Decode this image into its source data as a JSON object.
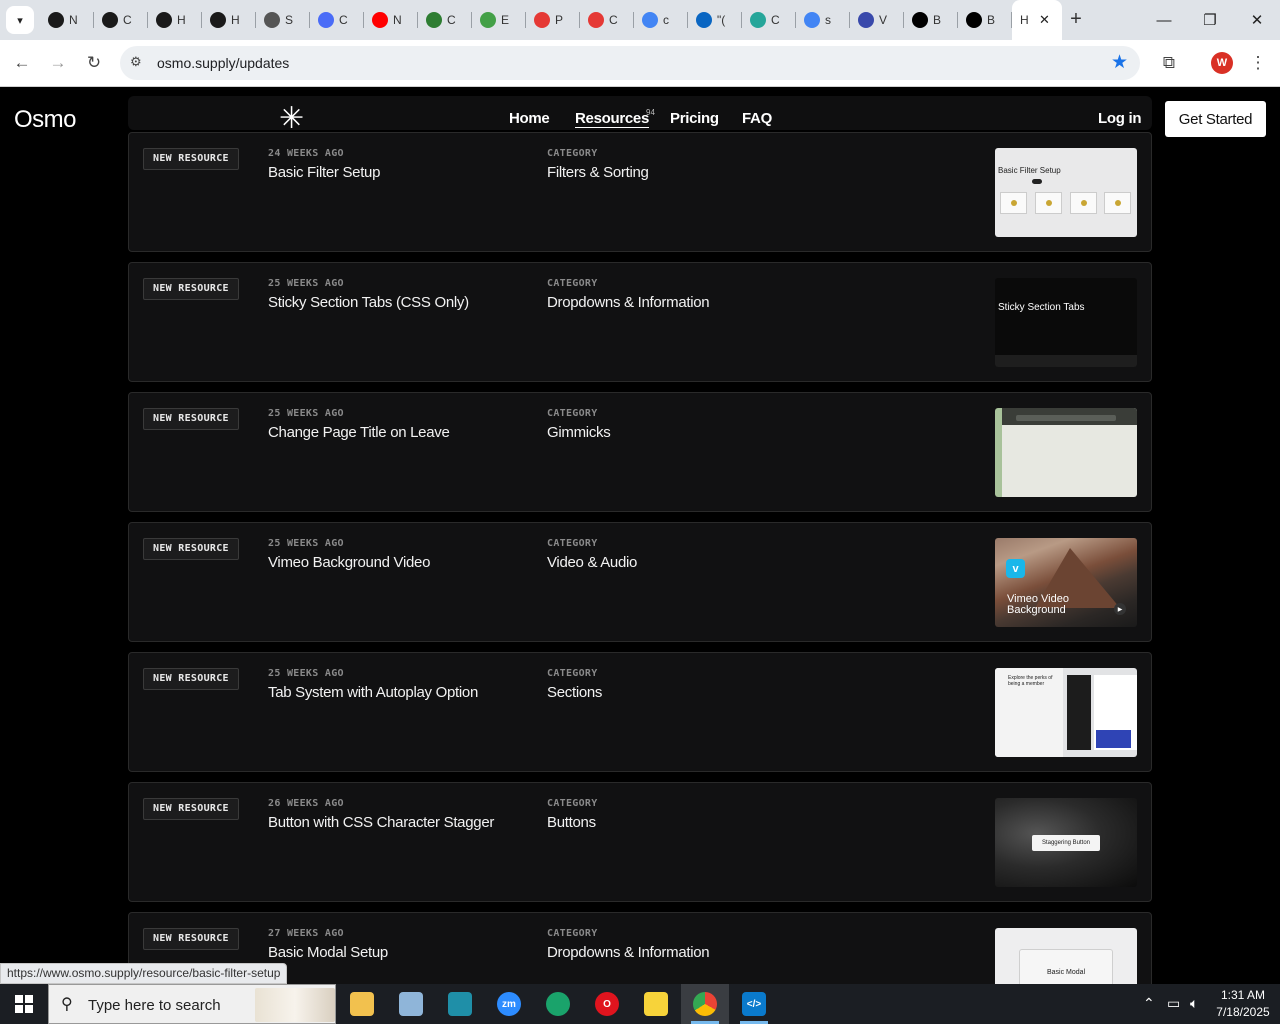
{
  "browser": {
    "tabs": [
      {
        "icon": "openai-icon",
        "label": "N",
        "color": "#1a1a1a"
      },
      {
        "icon": "openai-icon",
        "label": "C",
        "color": "#1a1a1a"
      },
      {
        "icon": "openai-icon",
        "label": "H",
        "color": "#1a1a1a"
      },
      {
        "icon": "openai-icon",
        "label": "H",
        "color": "#1a1a1a"
      },
      {
        "icon": "wordpress-icon",
        "label": "S",
        "color": "#555555"
      },
      {
        "icon": "app-icon",
        "label": "C",
        "color": "#4a6cf7"
      },
      {
        "icon": "youtube-icon",
        "label": "N",
        "color": "#ff0000"
      },
      {
        "icon": "webflow-icon",
        "label": "C",
        "color": "#2e7d32"
      },
      {
        "icon": "app-icon",
        "label": "E",
        "color": "#43a047"
      },
      {
        "icon": "app-icon",
        "label": "P",
        "color": "#e53935"
      },
      {
        "icon": "app-icon",
        "label": "C",
        "color": "#e53935"
      },
      {
        "icon": "google-icon",
        "label": "c",
        "color": "#4285f4"
      },
      {
        "icon": "linkedin-icon",
        "label": "\"(",
        "color": "#0a66c2"
      },
      {
        "icon": "app-icon",
        "label": "C",
        "color": "#26a69a"
      },
      {
        "icon": "google-icon",
        "label": "s",
        "color": "#4285f4"
      },
      {
        "icon": "app-icon",
        "label": "V",
        "color": "#3949ab"
      },
      {
        "icon": "x-icon",
        "label": "B",
        "color": "#000000"
      },
      {
        "icon": "x-icon",
        "label": "B",
        "color": "#000000"
      }
    ],
    "active_tab_label": "H",
    "url": "osmo.supply/updates",
    "profile_initial": "W",
    "status_url": "https://www.osmo.supply/resource/basic-filter-setup"
  },
  "site": {
    "logo": "Osmo",
    "nav": {
      "home": "Home",
      "resources": "Resources",
      "resources_count": "94",
      "pricing": "Pricing",
      "faq": "FAQ",
      "login": "Log in",
      "cta": "Get Started"
    },
    "items": [
      {
        "badge": "NEW RESOURCE",
        "when": "24 WEEKS AGO",
        "title": "Basic Filter Setup",
        "category_label": "CATEGORY",
        "category": "Filters & Sorting",
        "thumb_text": "Basic Filter Setup"
      },
      {
        "badge": "NEW RESOURCE",
        "when": "25 WEEKS AGO",
        "title": "Sticky Section Tabs (CSS Only)",
        "category_label": "CATEGORY",
        "category": "Dropdowns & Information",
        "thumb_text": "Sticky Section Tabs"
      },
      {
        "badge": "NEW RESOURCE",
        "when": "25 WEEKS AGO",
        "title": "Change Page Title on Leave",
        "category_label": "CATEGORY",
        "category": "Gimmicks",
        "thumb_text": ""
      },
      {
        "badge": "NEW RESOURCE",
        "when": "25 WEEKS AGO",
        "title": "Vimeo Background Video",
        "category_label": "CATEGORY",
        "category": "Video & Audio",
        "thumb_text": "Vimeo Video Background"
      },
      {
        "badge": "NEW RESOURCE",
        "when": "25 WEEKS AGO",
        "title": "Tab System with Autoplay Option",
        "category_label": "CATEGORY",
        "category": "Sections",
        "thumb_text": "Explore the perks of being a member"
      },
      {
        "badge": "NEW RESOURCE",
        "when": "26 WEEKS AGO",
        "title": "Button with CSS Character Stagger",
        "category_label": "CATEGORY",
        "category": "Buttons",
        "thumb_text": "Staggering Button"
      },
      {
        "badge": "NEW RESOURCE",
        "when": "27 WEEKS AGO",
        "title": "Basic Modal Setup",
        "category_label": "CATEGORY",
        "category": "Dropdowns & Information",
        "thumb_text": "Basic Modal"
      }
    ]
  },
  "taskbar": {
    "search_placeholder": "Type here to search",
    "time": "1:31 AM",
    "date": "7/18/2025"
  }
}
